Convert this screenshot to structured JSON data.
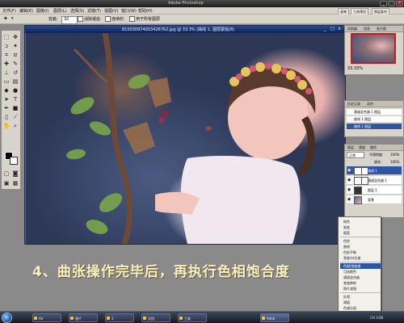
{
  "window": {
    "title": "Adobe Photoshop",
    "controls": [
      "_",
      "□",
      "×"
    ]
  },
  "menubar": {
    "items": [
      "文件(F)",
      "编辑(E)",
      "图像(I)",
      "图层(L)",
      "选择(S)",
      "滤镜(T)",
      "视图(V)",
      "窗口(W)",
      "帮助(H)"
    ],
    "panel_tabs": [
      "画笔",
      "工具预设",
      "图层复合"
    ]
  },
  "options": {
    "tolerance_label": "容差:",
    "tolerance_value": "32",
    "antialias_label": "消除锯齿",
    "contiguous_label": "连续的",
    "all_layers_label": "用于所有图层"
  },
  "document": {
    "title": "8150309740S3426762.jpg @ 33.3% (曲线 1, 图层蒙版/8)"
  },
  "navigator": {
    "tabs": [
      "导航器",
      "信息",
      "直方图"
    ],
    "zoom": "33.33%"
  },
  "history": {
    "tabs": [
      "历史记录",
      "动作"
    ],
    "items": [
      {
        "label": "通道混合器 1 图层",
        "selected": false
      },
      {
        "label": "曲线 1 图层",
        "selected": false
      },
      {
        "label": "曲线 1 图层",
        "selected": true
      }
    ]
  },
  "layers": {
    "tabs": [
      "图层",
      "通道",
      "路径"
    ],
    "mode": "正常",
    "opacity_label": "不透明度:",
    "opacity": "100%",
    "fill_label": "填充:",
    "fill": "100%",
    "items": [
      {
        "label": "曲线 1",
        "selected": true
      },
      {
        "label": "通道混合器 1",
        "selected": false
      },
      {
        "label": "图层 1",
        "selected": false
      },
      {
        "label": "背景",
        "selected": false
      }
    ]
  },
  "context_menu": {
    "items": [
      {
        "label": "纯色",
        "highlighted": false
      },
      {
        "label": "渐变",
        "highlighted": false
      },
      {
        "label": "图案",
        "highlighted": false
      },
      {
        "label": "色阶",
        "highlighted": false
      },
      {
        "label": "曲线",
        "highlighted": false
      },
      {
        "label": "色彩平衡",
        "highlighted": false
      },
      {
        "label": "亮度/对比度",
        "highlighted": false
      },
      {
        "label": "色相/饱和度",
        "highlighted": true
      },
      {
        "label": "可选颜色",
        "highlighted": false
      },
      {
        "label": "通道混合器",
        "highlighted": false
      },
      {
        "label": "渐变映射",
        "highlighted": false
      },
      {
        "label": "照片滤镜",
        "highlighted": false
      },
      {
        "label": "反相",
        "highlighted": false
      },
      {
        "label": "阈值",
        "highlighted": false
      },
      {
        "label": "色调分离",
        "highlighted": false
      }
    ]
  },
  "caption": "4、曲张操作完毕后，再执行色相饱合度",
  "taskbar": {
    "items": [
      "Ad",
      "图片",
      "2",
      "文档",
      "工具",
      "Adob"
    ],
    "active_index": 5,
    "tray": "CH 3:08"
  },
  "colors": {
    "foreground": "#000000",
    "background": "#ffffff",
    "selection": "#2f56a6",
    "caption": "#f7efc8"
  }
}
